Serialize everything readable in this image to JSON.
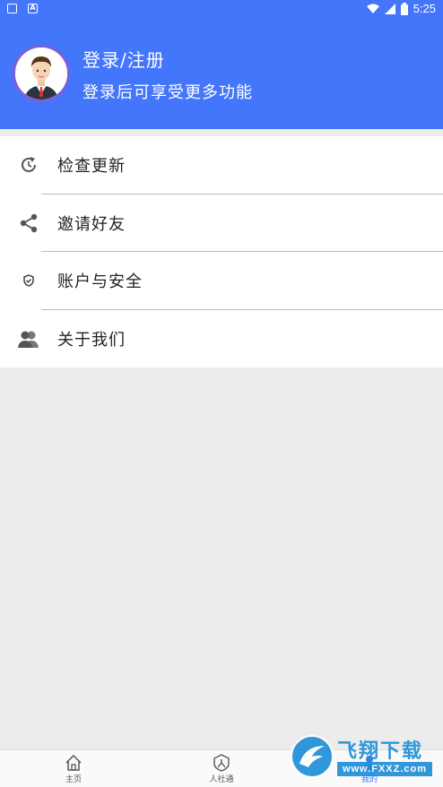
{
  "status_bar": {
    "time": "5:25",
    "left_icons": [
      "message-icon",
      "a-icon"
    ],
    "right_icons": [
      "wifi-icon",
      "signal-icon",
      "battery-icon"
    ]
  },
  "header": {
    "title": "登录/注册",
    "subtitle": "登录后可享受更多功能",
    "background_color": "#4476fb"
  },
  "menu": {
    "items": [
      {
        "label": "检查更新",
        "icon": "refresh-icon"
      },
      {
        "label": "邀请好友",
        "icon": "share-icon"
      },
      {
        "label": "账户与安全",
        "icon": "shield-icon"
      },
      {
        "label": "关于我们",
        "icon": "users-icon"
      }
    ]
  },
  "bottom_nav": {
    "tabs": [
      {
        "label": "主页",
        "icon": "home-icon",
        "active": false
      },
      {
        "label": "人社通",
        "icon": "person-shield-icon",
        "active": false
      },
      {
        "label": "我的",
        "icon": "profile-icon",
        "active": true
      }
    ],
    "active_color": "#4476fb"
  },
  "watermark": {
    "text": "飞翔下载",
    "url": "www.FXXZ.com"
  }
}
